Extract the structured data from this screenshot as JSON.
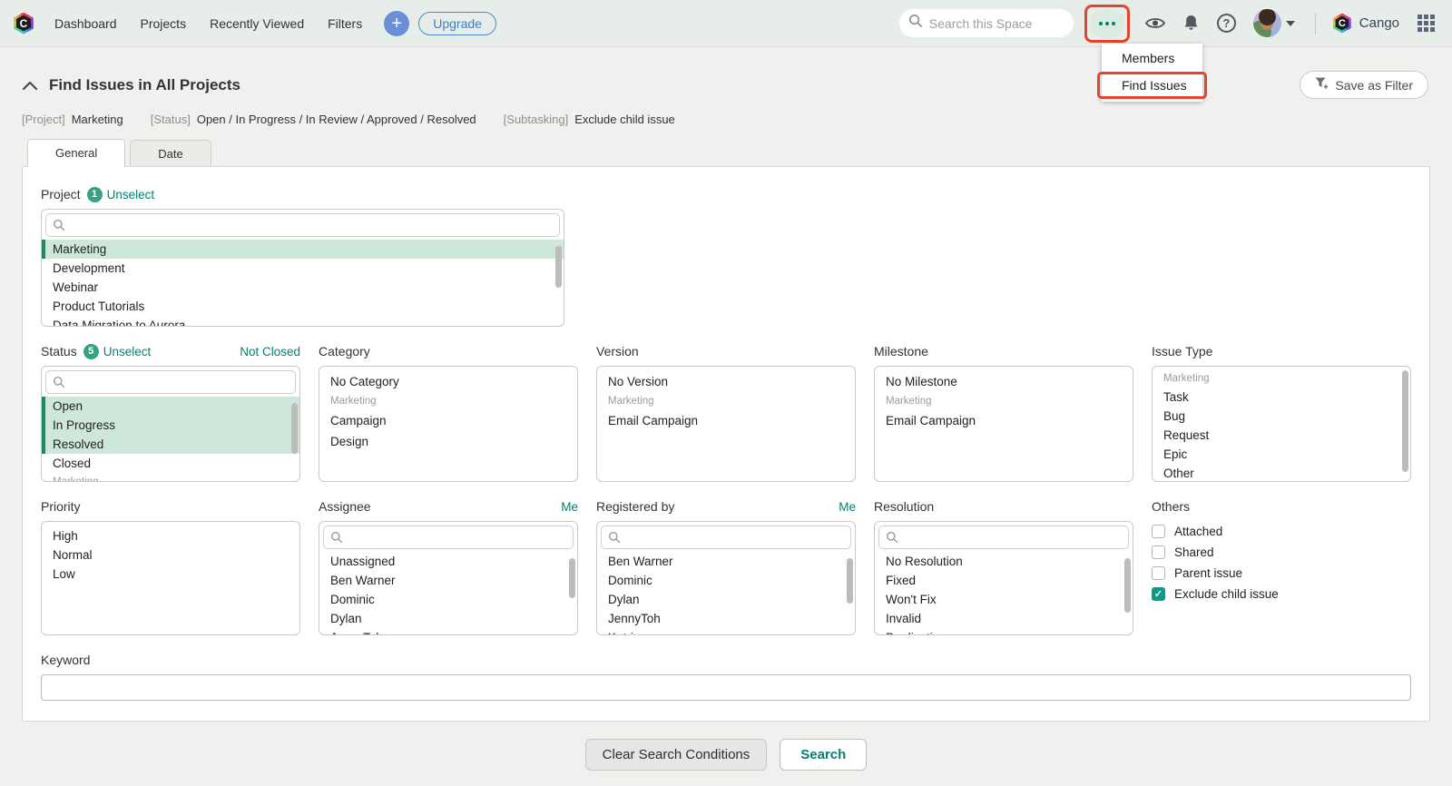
{
  "colors": {
    "accent": "#00836f",
    "selected_bg": "#cde7da",
    "selected_bar": "#1f8a60",
    "highlight_red": "#e8432c",
    "navbar_bg": "#e7eee9",
    "page_bg": "#f0f0ee"
  },
  "topbar": {
    "logo_letter": "C",
    "nav_links": [
      "Dashboard",
      "Projects",
      "Recently Viewed",
      "Filters"
    ],
    "plus_label": "+",
    "upgrade_label": "Upgrade",
    "search_placeholder": "Search this Space",
    "help_glyph": "?",
    "space_name": "Cango",
    "space_logo_letter": "C"
  },
  "overflow_menu": {
    "items": [
      "Members",
      "Find Issues"
    ]
  },
  "header": {
    "title": "Find Issues in All Projects",
    "save_filter_label": "Save as Filter"
  },
  "summary": [
    {
      "label": "[Project]",
      "value": "Marketing"
    },
    {
      "label": "[Status]",
      "value": "Open / In Progress / In Review / Approved / Resolved"
    },
    {
      "label": "[Subtasking]",
      "value": "Exclude child issue"
    }
  ],
  "tabs": [
    {
      "label": "General",
      "active": true
    },
    {
      "label": "Date",
      "active": false
    }
  ],
  "panels": {
    "project": {
      "label": "Project",
      "count": "1",
      "unselect_label": "Unselect",
      "items": [
        {
          "label": "Marketing",
          "selected": true
        },
        {
          "label": "Development"
        },
        {
          "label": "Webinar"
        },
        {
          "label": "Product Tutorials"
        },
        {
          "label": "Data Migration to Aurora"
        }
      ]
    },
    "status": {
      "label": "Status",
      "count": "5",
      "unselect_label": "Unselect",
      "not_closed_label": "Not Closed",
      "items": [
        {
          "label": "Open",
          "selected": true
        },
        {
          "label": "In Progress",
          "selected": true
        },
        {
          "label": "Resolved",
          "selected": true
        },
        {
          "label": "Closed"
        },
        {
          "label": "Marketing",
          "group": true
        }
      ]
    },
    "category": {
      "label": "Category",
      "items": [
        {
          "label": "No Category"
        },
        {
          "label": "Marketing",
          "group": true
        },
        {
          "label": "Campaign"
        },
        {
          "label": "Design"
        }
      ]
    },
    "version": {
      "label": "Version",
      "items": [
        {
          "label": "No Version"
        },
        {
          "label": "Marketing",
          "group": true
        },
        {
          "label": "Email Campaign"
        }
      ]
    },
    "milestone": {
      "label": "Milestone",
      "items": [
        {
          "label": "No Milestone"
        },
        {
          "label": "Marketing",
          "group": true
        },
        {
          "label": "Email Campaign"
        }
      ]
    },
    "issue_type": {
      "label": "Issue Type",
      "items": [
        {
          "label": "Marketing",
          "group": true
        },
        {
          "label": "Task"
        },
        {
          "label": "Bug"
        },
        {
          "label": "Request"
        },
        {
          "label": "Epic"
        },
        {
          "label": "Other"
        }
      ]
    },
    "priority": {
      "label": "Priority",
      "items": [
        {
          "label": "High"
        },
        {
          "label": "Normal"
        },
        {
          "label": "Low"
        }
      ]
    },
    "assignee": {
      "label": "Assignee",
      "me_label": "Me",
      "items": [
        {
          "label": "Unassigned"
        },
        {
          "label": "Ben Warner"
        },
        {
          "label": "Dominic"
        },
        {
          "label": "Dylan"
        },
        {
          "label": "JennyToh"
        }
      ]
    },
    "registered_by": {
      "label": "Registered by",
      "me_label": "Me",
      "items": [
        {
          "label": "Ben Warner"
        },
        {
          "label": "Dominic"
        },
        {
          "label": "Dylan"
        },
        {
          "label": "JennyToh"
        },
        {
          "label": "Katrina"
        }
      ]
    },
    "resolution": {
      "label": "Resolution",
      "items": [
        {
          "label": "No Resolution"
        },
        {
          "label": "Fixed"
        },
        {
          "label": "Won't Fix"
        },
        {
          "label": "Invalid"
        },
        {
          "label": "Duplication"
        }
      ]
    },
    "others": {
      "label": "Others",
      "options": [
        {
          "label": "Attached",
          "checked": false
        },
        {
          "label": "Shared",
          "checked": false
        },
        {
          "label": "Parent issue",
          "checked": false
        },
        {
          "label": "Exclude child issue",
          "checked": true
        }
      ]
    },
    "keyword": {
      "label": "Keyword",
      "value": ""
    }
  },
  "footer": {
    "clear_label": "Clear Search Conditions",
    "search_label": "Search"
  }
}
